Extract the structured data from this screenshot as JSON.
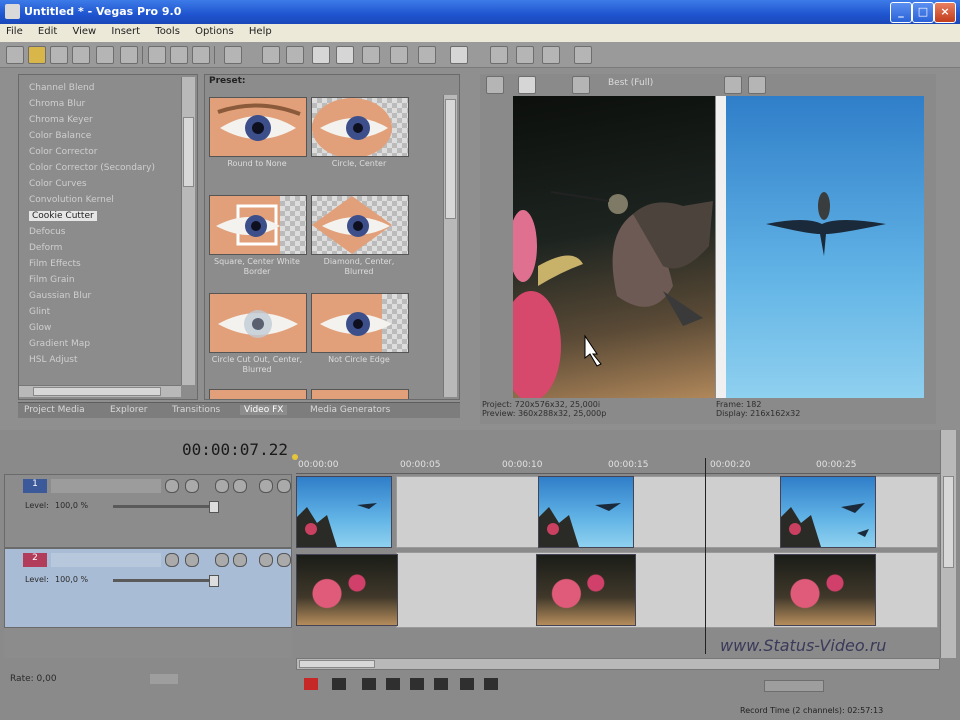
{
  "window": {
    "title": "Untitled * - Vegas Pro 9.0"
  },
  "menu": [
    "File",
    "Edit",
    "View",
    "Insert",
    "Tools",
    "Options",
    "Help"
  ],
  "fx_list": {
    "items": [
      "Channel Blend",
      "Chroma Blur",
      "Chroma Keyer",
      "Color Balance",
      "Color Corrector",
      "Color Corrector (Secondary)",
      "Color Curves",
      "Convolution Kernel",
      "Cookie Cutter",
      "Defocus",
      "Deform",
      "Film Effects",
      "Film Grain",
      "Gaussian Blur",
      "Glint",
      "Glow",
      "Gradient Map",
      "HSL Adjust"
    ],
    "selected_index": 8
  },
  "presets": {
    "header": "Preset:",
    "items": [
      "Round to None",
      "Circle, Center",
      "Square, Center White Border",
      "Diamond, Center, Blurred",
      "Circle Cut Out, Center, Blurred",
      "Not Circle Edge",
      ""
    ]
  },
  "bottom_tabs": [
    "Project Media",
    "Explorer",
    "Transitions",
    "Video FX",
    "Media Generators"
  ],
  "active_tab_index": 3,
  "preview": {
    "project_label": "Project:",
    "project_value": "720x576x32, 25,000i",
    "preview_label": "Preview:",
    "preview_value": "360x288x32, 25,000p",
    "frame_label": "Frame:",
    "frame_value": "182",
    "display_label": "Display:",
    "display_value": "216x162x32",
    "quality": "Best (Full)"
  },
  "timeline": {
    "timecode": "00:00:07.22",
    "ruler_marks": [
      "00:00:00",
      "00:00:05",
      "00:00:10",
      "00:00:15",
      "00:00:20",
      "00:00:25"
    ],
    "tracks": [
      {
        "number": "1",
        "level_label": "Level:",
        "level_value": "100,0 %"
      },
      {
        "number": "2",
        "level_label": "Level:",
        "level_value": "100,0 %"
      }
    ],
    "rate_label": "Rate: 0,00",
    "watermark": "www.Status-Video.ru",
    "record_time": "Record Time (2 channels): 02:57:13"
  },
  "colors": {
    "title_bar": "#245edb",
    "panel": "#8c8c8c",
    "menu": "#ece9d8"
  }
}
